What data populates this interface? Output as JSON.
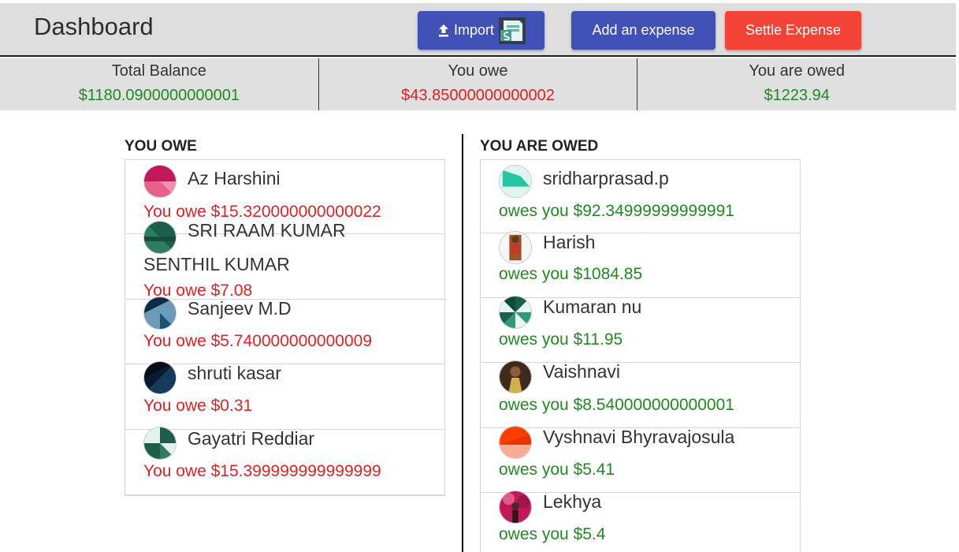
{
  "header": {
    "title": "Dashboard",
    "import_label": "Import",
    "add_expense_label": "Add an expense",
    "settle_label": "Settle Expense"
  },
  "summary": {
    "total_label": "Total Balance",
    "total_value": "$1180.0900000000001",
    "owe_label": "You owe",
    "owe_value": "$43.85000000000002",
    "owed_label": "You are owed",
    "owed_value": "$1223.94"
  },
  "you_owe": {
    "heading": "YOU OWE",
    "items": [
      {
        "name": "Az Harshini",
        "amount": "You owe $15.320000000000022"
      },
      {
        "name": "SRI RAAM KUMAR",
        "name2": "SENTHIL KUMAR",
        "amount": "You owe $7.08"
      },
      {
        "name": "Sanjeev M.D",
        "amount": "You owe $5.740000000000009"
      },
      {
        "name": "shruti kasar",
        "amount": "You owe $0.31"
      },
      {
        "name": "Gayatri Reddiar",
        "amount": "You owe $15.399999999999999"
      }
    ]
  },
  "you_are_owed": {
    "heading": "YOU ARE OWED",
    "items": [
      {
        "name": "sridharprasad.p",
        "amount": "owes you $92.34999999999991"
      },
      {
        "name": "Harish",
        "amount": "owes you $1084.85"
      },
      {
        "name": "Kumaran nu",
        "amount": "owes you $11.95"
      },
      {
        "name": "Vaishnavi",
        "amount": "owes you $8.540000000000001"
      },
      {
        "name": "Vyshnavi Bhyravajosula",
        "amount": "owes you $5.41"
      },
      {
        "name": "Lekhya",
        "amount": "owes you $5.4"
      }
    ]
  },
  "colors": {
    "primary": "#3f51b5",
    "danger": "#f44336",
    "positive": "#1f8a1f",
    "negative": "#e02222"
  }
}
